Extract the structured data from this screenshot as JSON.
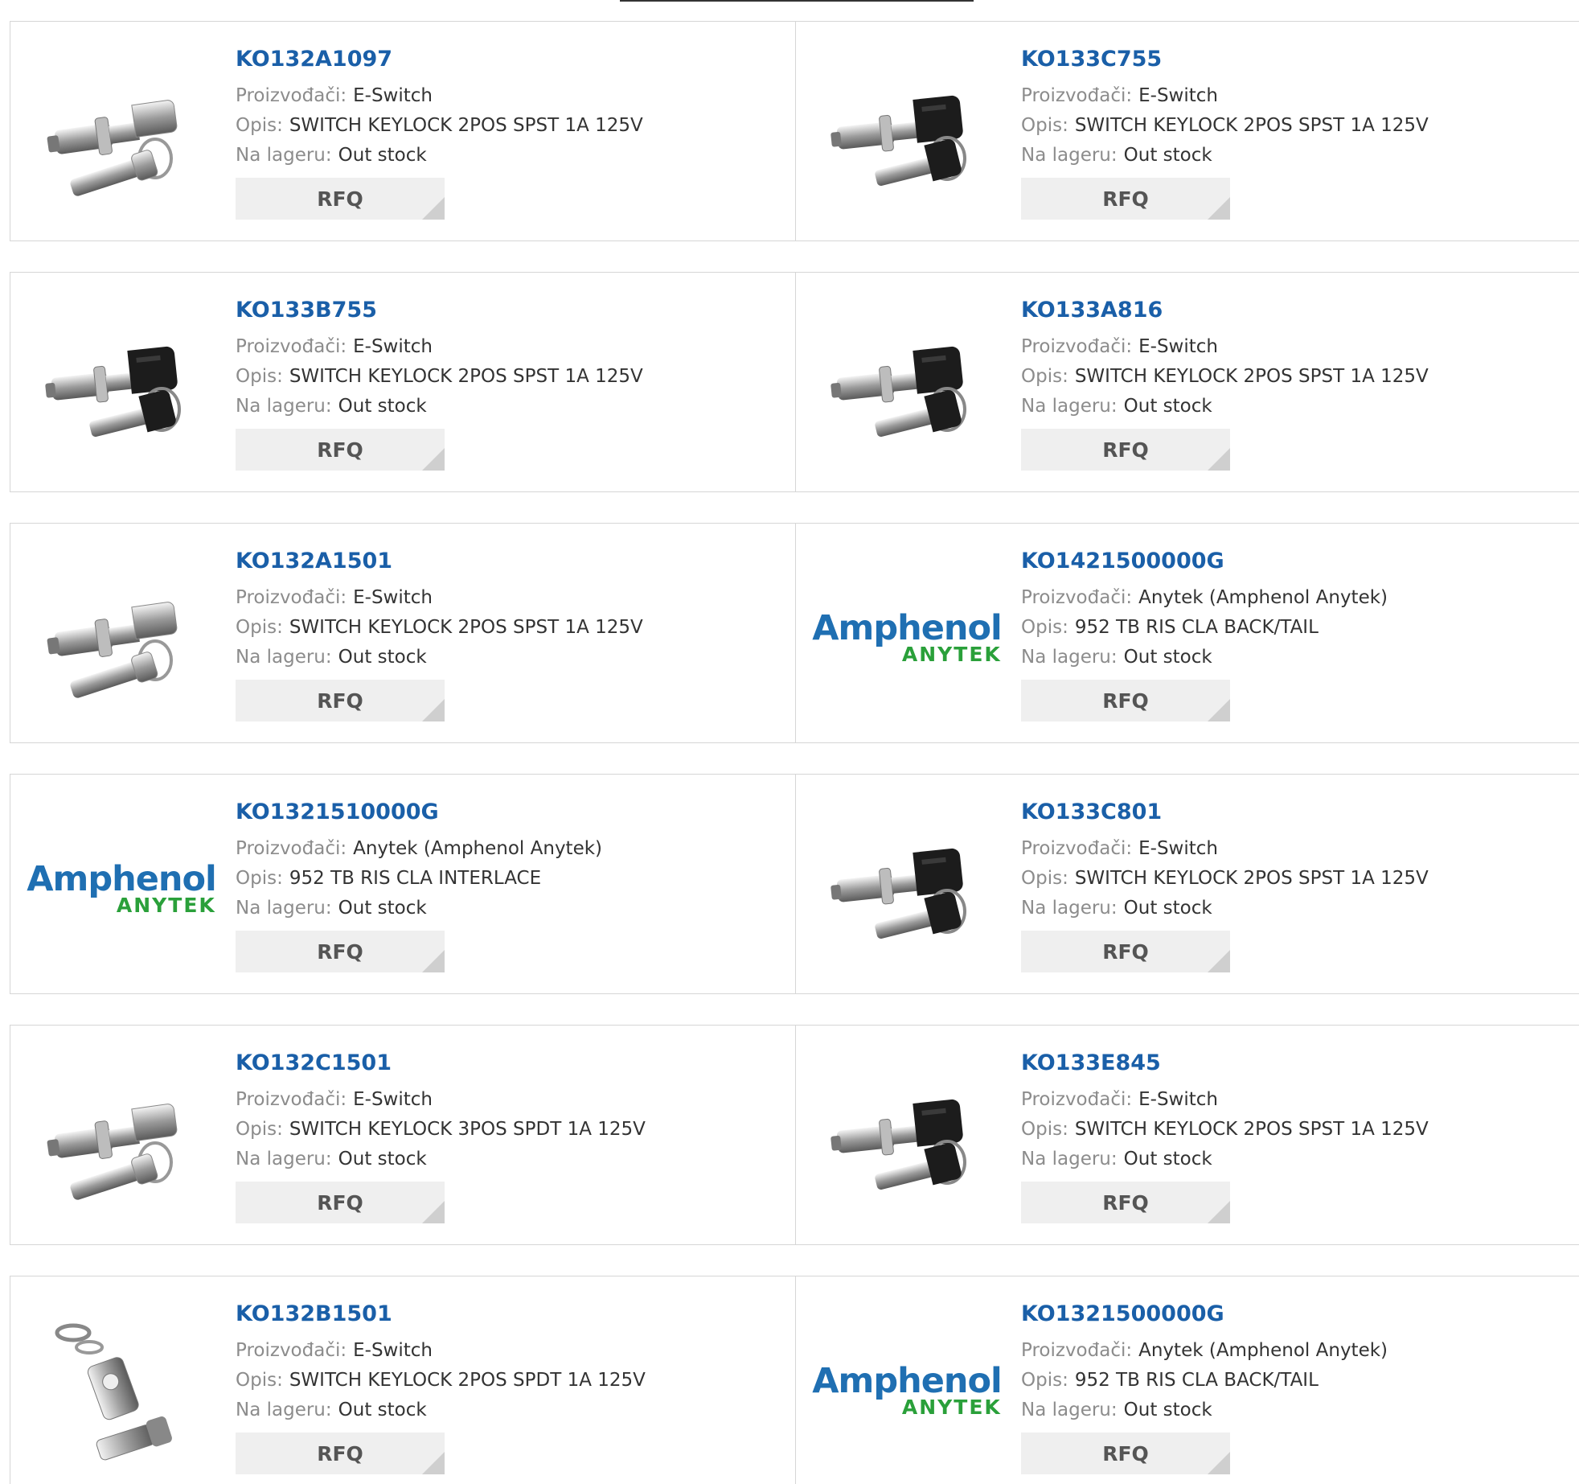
{
  "labels": {
    "manufacturer": "Proizvođači:",
    "description": "Opis:",
    "stock": "Na lageru:",
    "rfq": "RFQ"
  },
  "products": [
    {
      "part": "KO132A1097",
      "manufacturer": "E-Switch",
      "description": "SWITCH KEYLOCK 2POS SPST 1A 125V",
      "stock": "Out stock",
      "image": "silver-keylock-icon"
    },
    {
      "part": "KO133C755",
      "manufacturer": "E-Switch",
      "description": "SWITCH KEYLOCK 2POS SPST 1A 125V",
      "stock": "Out stock",
      "image": "black-keylock-icon"
    },
    {
      "part": "KO133B755",
      "manufacturer": "E-Switch",
      "description": "SWITCH KEYLOCK 2POS SPST 1A 125V",
      "stock": "Out stock",
      "image": "black-keylock-icon"
    },
    {
      "part": "KO133A816",
      "manufacturer": "E-Switch",
      "description": "SWITCH KEYLOCK 2POS SPST 1A 125V",
      "stock": "Out stock",
      "image": "black-keylock-icon"
    },
    {
      "part": "KO132A1501",
      "manufacturer": "E-Switch",
      "description": "SWITCH KEYLOCK 2POS SPST 1A 125V",
      "stock": "Out stock",
      "image": "silver-keylock-icon"
    },
    {
      "part": "KO1421500000G",
      "manufacturer": "Anytek (Amphenol Anytek)",
      "description": "952 TB RIS CLA BACK/TAIL",
      "stock": "Out stock",
      "image": "amphenol-anytek-logo"
    },
    {
      "part": "KO1321510000G",
      "manufacturer": "Anytek (Amphenol Anytek)",
      "description": "952 TB RIS CLA INTERLACE",
      "stock": "Out stock",
      "image": "amphenol-anytek-logo"
    },
    {
      "part": "KO133C801",
      "manufacturer": "E-Switch",
      "description": "SWITCH KEYLOCK 2POS SPST 1A 125V",
      "stock": "Out stock",
      "image": "black-keylock-icon"
    },
    {
      "part": "KO132C1501",
      "manufacturer": "E-Switch",
      "description": "SWITCH KEYLOCK 3POS SPDT 1A 125V",
      "stock": "Out stock",
      "image": "silver-keylock-icon"
    },
    {
      "part": "KO133E845",
      "manufacturer": "E-Switch",
      "description": "SWITCH KEYLOCK 2POS SPST 1A 125V",
      "stock": "Out stock",
      "image": "black-keylock-icon"
    },
    {
      "part": "KO132B1501",
      "manufacturer": "E-Switch",
      "description": "SWITCH KEYLOCK 2POS SPDT 1A 125V",
      "stock": "Out stock",
      "image": "vertical-keylock-icon"
    },
    {
      "part": "KO1321500000G",
      "manufacturer": "Anytek (Amphenol Anytek)",
      "description": "952 TB RIS CLA BACK/TAIL",
      "stock": "Out stock",
      "image": "amphenol-anytek-logo"
    }
  ],
  "logo_text": {
    "amphenol": "Amphenol",
    "anytek": "ANYTEK"
  },
  "colors": {
    "part_link": "#1a5fa8",
    "label": "#8c8c8c",
    "amphenol_blue": "#1f6fb2",
    "anytek_green": "#2aa03a"
  }
}
